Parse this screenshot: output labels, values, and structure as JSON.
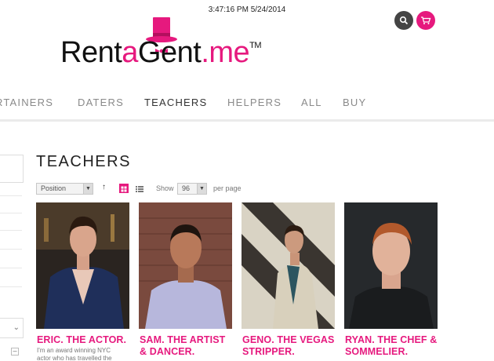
{
  "status_bar": {
    "time": "3:47:16 PM 5/24/2014"
  },
  "header": {
    "logo_parts": [
      "Rent",
      "a",
      "Gent",
      ".me",
      "TM"
    ],
    "icons": [
      "search-icon",
      "cart-icon"
    ]
  },
  "nav": {
    "items": [
      "RTAINERS",
      "DATERS",
      "TEACHERS",
      "HELPERS",
      "ALL",
      "BUY"
    ],
    "active": "TEACHERS"
  },
  "page": {
    "title": "TEACHERS"
  },
  "toolbar": {
    "sort_by": "Position",
    "show_label": "Show",
    "limit": "96",
    "per_page_label": "per page"
  },
  "products": [
    {
      "name_line1": "ERIC. THE ACTOR.",
      "name_line2": "",
      "description": "I'm an award winning NYC actor who has travelled the"
    },
    {
      "name_line1": "SAM. THE ARTIST",
      "name_line2": "& DANCER.",
      "description": ""
    },
    {
      "name_line1": "GENO. THE VEGAS",
      "name_line2": "STRIPPER.",
      "description": ""
    },
    {
      "name_line1": "RYAN. THE CHEF &",
      "name_line2": "SOMMELIER.",
      "description": ""
    }
  ],
  "colors": {
    "accent": "#e6197e",
    "text": "#333333",
    "nav_inactive": "#8a8a8a"
  }
}
